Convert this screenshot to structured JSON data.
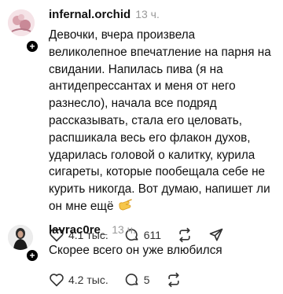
{
  "comments": [
    {
      "username": "infernal.orchid",
      "time": "13 ч.",
      "text": "Девочки, вчера произвела великолепное впечатление на парня на свидании. Напилась пива (я на антидепрессантах и меня от него разнесло), начала все подряд рассказывать, стала его целовать, распшикала весь его флакон духов, ударилась головой о калитку, курила сигареты, которые пообещала себе не курить никогда. Вот думаю, напишет ли он мне ещё",
      "likes": "4.1 тыс.",
      "replies": "611",
      "follow": "+"
    },
    {
      "username": "lavrac0re_",
      "time": "13 ч.",
      "text": "Скорее всего он уже влюбился",
      "likes": "4.2 тыс.",
      "replies": "5",
      "follow": "+"
    }
  ],
  "icons": {
    "like": "heart-icon",
    "reply": "comment-bubble-icon",
    "repost": "repost-icon",
    "share": "send-icon",
    "emoji": "thinking-hand-emoji"
  }
}
